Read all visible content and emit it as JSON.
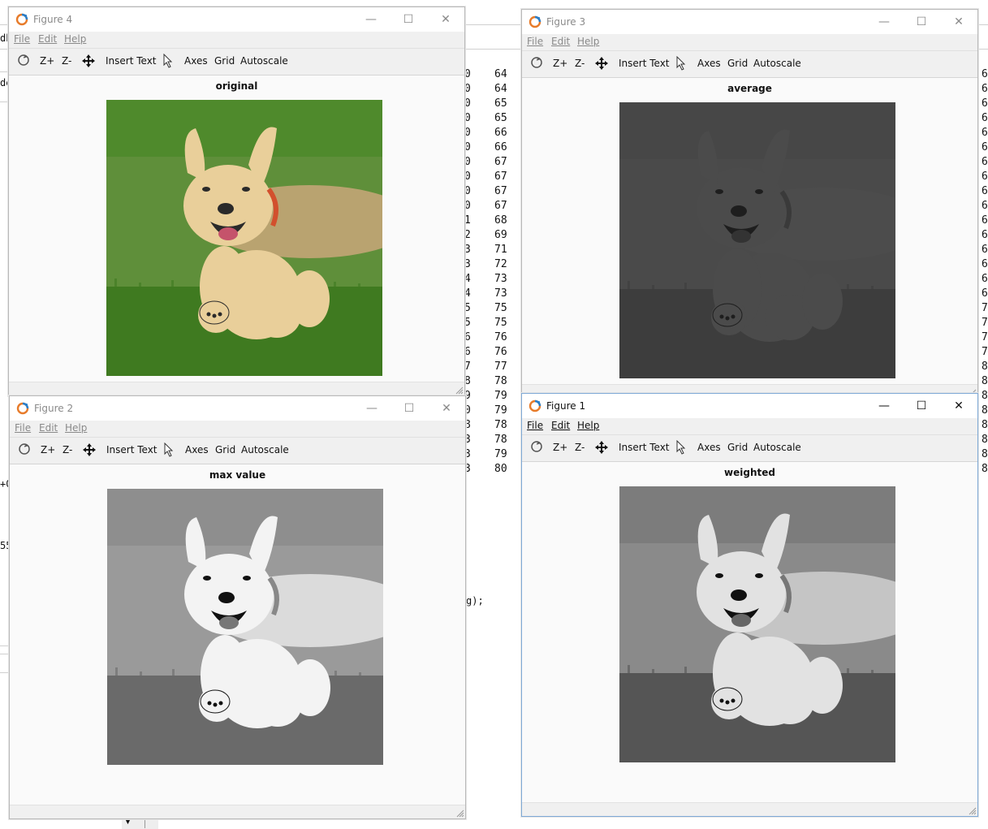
{
  "background": {
    "column_a": [
      "64",
      "64",
      "65",
      "65",
      "66",
      "66",
      "67",
      "67",
      "67",
      "67",
      "68",
      "69",
      "71",
      "72",
      "73",
      "73",
      "75",
      "75",
      "76",
      "76",
      "77",
      "78",
      "79",
      "79",
      "78",
      "78",
      "79",
      "80"
    ],
    "column_a_prefix": [
      "0",
      "0",
      "0",
      "0",
      "0",
      "0",
      "0",
      "0",
      "0",
      "0",
      "1",
      "2",
      "3",
      "3",
      "4",
      "4",
      "5",
      "5",
      "6",
      "6",
      "7",
      "8",
      "9",
      "0",
      "8",
      "3",
      "3",
      "3"
    ],
    "column_b": [
      "6",
      "6",
      "6",
      "6",
      "6",
      "6",
      "6",
      "6",
      "6",
      "6",
      "6",
      "6",
      "6",
      "6",
      "6",
      "6",
      "7",
      "7",
      "7",
      "7",
      "8",
      "8",
      "8",
      "8",
      "8",
      "8",
      "8",
      "8"
    ],
    "fragments": {
      "db": "db",
      "de": "de",
      "zero": "+0",
      "five": "55",
      "code": "g);"
    }
  },
  "windows": [
    {
      "id": "figure4",
      "title": "Figure 4",
      "menus": [
        "File",
        "Edit",
        "Help"
      ],
      "toolbar": {
        "zoom_in": "Z+",
        "zoom_out": "Z-",
        "insert_text": "Insert Text",
        "axes": "Axes",
        "grid": "Grid",
        "autoscale": "Autoscale"
      },
      "plot_title": "original",
      "image": "color puppy running on grass"
    },
    {
      "id": "figure3",
      "title": "Figure 3",
      "menus": [
        "File",
        "Edit",
        "Help"
      ],
      "toolbar": {
        "zoom_in": "Z+",
        "zoom_out": "Z-",
        "insert_text": "Insert Text",
        "axes": "Axes",
        "grid": "Grid",
        "autoscale": "Autoscale"
      },
      "plot_title": "average",
      "image": "dark gray puppy"
    },
    {
      "id": "figure2",
      "title": "Figure 2",
      "menus": [
        "File",
        "Edit",
        "Help"
      ],
      "toolbar": {
        "zoom_in": "Z+",
        "zoom_out": "Z-",
        "insert_text": "Insert Text",
        "axes": "Axes",
        "grid": "Grid",
        "autoscale": "Autoscale"
      },
      "plot_title": "max value",
      "image": "bright grayscale puppy"
    },
    {
      "id": "figure1",
      "title": "Figure 1",
      "menus": [
        "File",
        "Edit",
        "Help"
      ],
      "toolbar": {
        "zoom_in": "Z+",
        "zoom_out": "Z-",
        "insert_text": "Insert Text",
        "axes": "Axes",
        "grid": "Grid",
        "autoscale": "Autoscale"
      },
      "plot_title": "weighted",
      "image": "grayscale puppy"
    }
  ],
  "icons": {
    "app": "octave-logo-icon",
    "minimize": "minimize-icon",
    "maximize": "maximize-icon",
    "close": "close-icon",
    "rotate": "rotate-icon",
    "pan": "pan-icon",
    "select": "pointer-icon"
  },
  "colors": {
    "active_border": "#7ea9d6",
    "inactive_text": "#8a8a8a",
    "toolbar_bg": "#f0f0f0"
  }
}
